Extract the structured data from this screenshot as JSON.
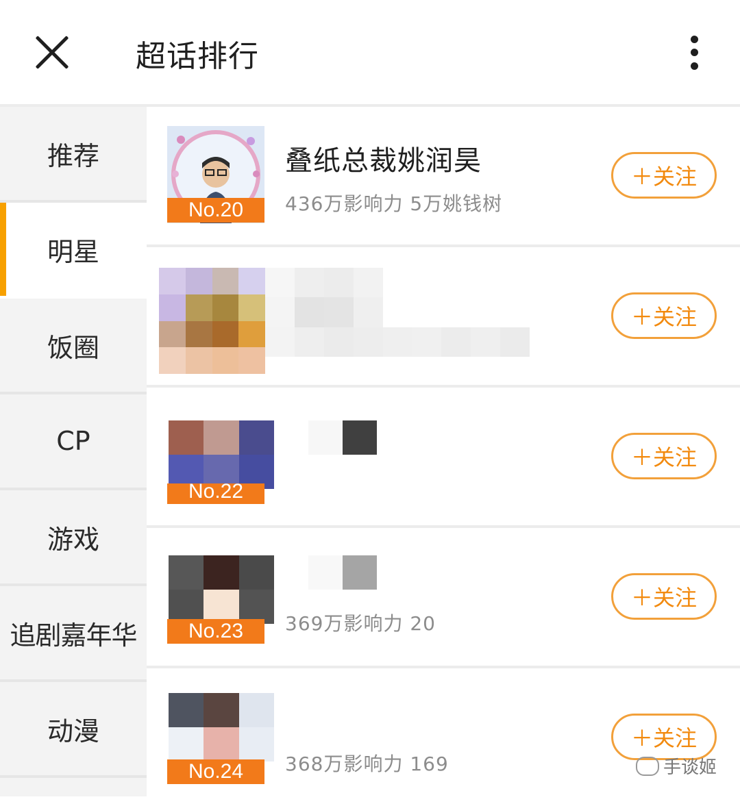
{
  "header": {
    "title": "超话排行"
  },
  "sidebar": {
    "items": [
      {
        "label": "推荐"
      },
      {
        "label": "明星",
        "active": true
      },
      {
        "label": "饭圈"
      },
      {
        "label": "CP"
      },
      {
        "label": "游戏"
      },
      {
        "label": "追剧嘉年华"
      },
      {
        "label": "动漫"
      }
    ]
  },
  "list": {
    "rows": [
      {
        "rank": "No.20",
        "name": "叠纸总裁姚润昊",
        "stats": "436万影响力 5万姚钱树",
        "follow": "＋关注"
      },
      {
        "rank": "",
        "name": "",
        "stats": "",
        "follow": "＋关注"
      },
      {
        "rank": "No.22",
        "name": "",
        "stats": "",
        "follow": "＋关注"
      },
      {
        "rank": "No.23",
        "name": "",
        "stats": "369万影响力 20",
        "follow": "＋关注"
      },
      {
        "rank": "No.24",
        "name": "",
        "stats": "368万影响力 169",
        "follow": "＋关注"
      }
    ]
  },
  "watermark": {
    "text": "手谈姬"
  },
  "colors": {
    "accent": "#f7a000",
    "follow_text": "#f28a0f",
    "follow_border": "#f2a03a",
    "rank_bg": "#f27a1a"
  }
}
